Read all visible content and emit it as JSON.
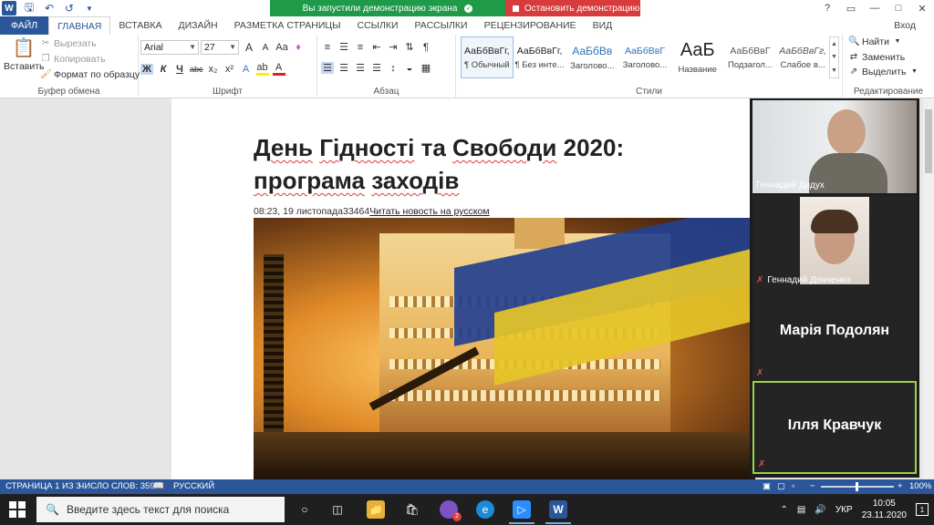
{
  "titlebar": {
    "app_icon": "W",
    "qat_icons": [
      "save-icon",
      "undo-icon",
      "redo-icon",
      "customize-icon"
    ],
    "window_controls": [
      "?",
      "▭",
      "—",
      "□",
      "✕"
    ]
  },
  "share_banner": {
    "info": "Вы запустили демонстрацию экрана",
    "stop": "Остановить демонстрацию",
    "info_color": "#1e9a49",
    "stop_color": "#d83b3b"
  },
  "tabs": {
    "file": "ФАЙЛ",
    "items": [
      "ГЛАВНАЯ",
      "ВСТАВКА",
      "ДИЗАЙН",
      "РАЗМЕТКА СТРАНИЦЫ",
      "ССЫЛКИ",
      "РАССЫЛКИ",
      "РЕЦЕНЗИРОВАНИЕ",
      "ВИД"
    ],
    "active": "ГЛАВНАЯ",
    "login": "Вход"
  },
  "ribbon": {
    "clipboard": {
      "paste": "Вставить",
      "cut": "Вырезать",
      "copy": "Копировать",
      "format_painter": "Формат по образцу",
      "label": "Буфер обмена"
    },
    "font": {
      "name": "Arial",
      "size": "27",
      "label": "Шрифт",
      "grow": "A",
      "shrink": "A",
      "case": "Aa",
      "bold": "Ж",
      "italic": "К",
      "underline": "Ч",
      "strike": "abc",
      "sub": "x₂",
      "sup": "x²",
      "effects": "A",
      "highlight": "ab",
      "color": "A"
    },
    "paragraph": {
      "label": "Абзац",
      "pilcrow": "¶"
    },
    "styles": {
      "label": "Стили",
      "items": [
        {
          "sample": "АаБбВвГг,",
          "name": "¶ Обычный"
        },
        {
          "sample": "АаБбВвГг,",
          "name": "¶ Без инте..."
        },
        {
          "sample": "АаБбВв",
          "name": "Заголово..."
        },
        {
          "sample": "АаБбВвГ",
          "name": "Заголово..."
        },
        {
          "sample": "АаБ",
          "name": "Название"
        },
        {
          "sample": "АаБбВвГ",
          "name": "Подзагол..."
        },
        {
          "sample": "АаБбВвГг,",
          "name": "Слабое в..."
        }
      ]
    },
    "editing": {
      "label": "Редактирование",
      "find": "Найти",
      "replace": "Заменить",
      "select": "Выделить"
    }
  },
  "document": {
    "title_line1_word": "День",
    "title_line1_mid": " ",
    "title_line1_word2": "Гідності",
    "title_line1_rest": " та ",
    "title_line1_word3": "Свободи",
    "title_line1_end": " 2020:",
    "title_line2_word": "програма",
    "title_line2_rest": " ",
    "title_line2_word2": "заходів",
    "meta_time": "08:23, 19 листопада",
    "meta_views": "33464",
    "meta_link": "Читать новость на русском"
  },
  "video_panel": {
    "participants": [
      {
        "name": "Геннадий Дидух",
        "muted": false
      },
      {
        "name": "Геннадий Донченко",
        "muted": true
      },
      {
        "name": "Марія Подолян",
        "muted": true
      },
      {
        "name": "Ілля Кравчук",
        "muted": true
      }
    ],
    "active_speaker_color": "#9bd24a"
  },
  "statusbar": {
    "page": "СТРАНИЦА 1 ИЗ 3",
    "words": "ЧИСЛО СЛОВ: 359",
    "language": "РУССКИЙ",
    "zoom": "100%",
    "zoom_level": 1.0,
    "color": "#2b579a"
  },
  "taskbar": {
    "search_placeholder": "Введите здесь текст для поиска",
    "apps": [
      "cortana-icon",
      "taskview-icon",
      "explorer-icon",
      "store-icon",
      "viber-icon",
      "edge-icon",
      "zoom-icon",
      "word-icon"
    ],
    "viber_badge": "2",
    "language": "УКР",
    "time": "10:05",
    "date": "23.11.2020",
    "notifications": "1"
  }
}
